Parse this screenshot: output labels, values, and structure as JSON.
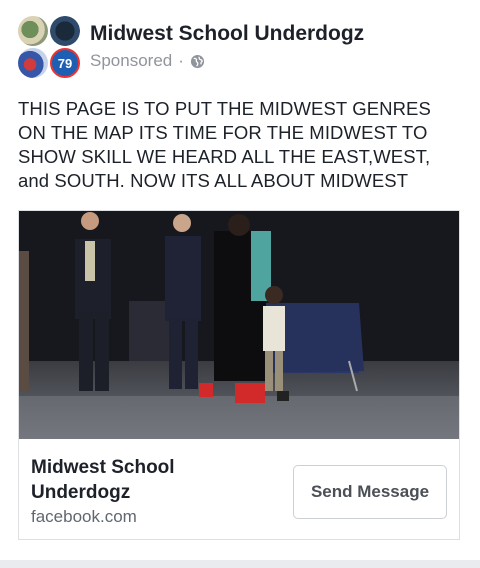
{
  "post": {
    "page_name": "Midwest School Underdogz",
    "sponsored_label": "Sponsored",
    "separator": "·",
    "avatar_badge": "79",
    "text": "THIS PAGE IS TO PUT THE MIDWEST GENRES ON THE MAP ITS TIME FOR THE MIDWEST TO SHOW SKILL WE HEARD ALL THE EAST,WEST, and SOUTH. NOW ITS ALL ABOUT MIDWEST"
  },
  "link_card": {
    "title": "Midwest School Underdogz",
    "domain": "facebook.com",
    "cta_label": "Send Message"
  },
  "icons": {
    "privacy": "globe-icon"
  },
  "colors": {
    "text": "#1d2129",
    "secondary": "#90949c",
    "border": "#dddfe2"
  }
}
